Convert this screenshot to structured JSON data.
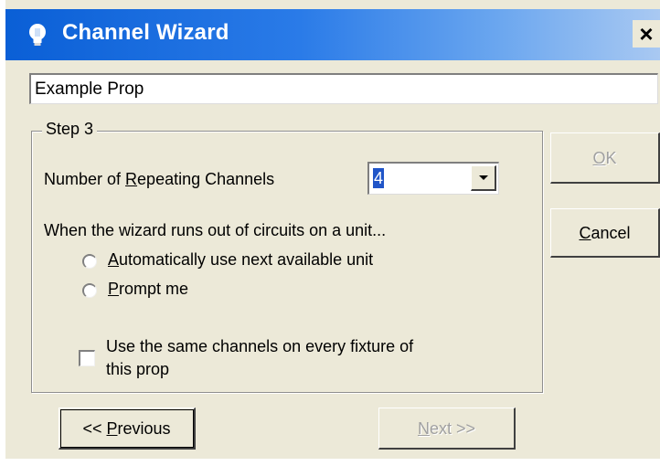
{
  "window": {
    "title": "Channel Wizard",
    "icon": "lightbulb-icon",
    "close_label": "×",
    "accent": "#0a5fd6"
  },
  "prop_name": {
    "value": "Example Prop"
  },
  "step": {
    "legend": "Step 3",
    "repeating_label_pre": "Number of ",
    "repeating_label_key": "R",
    "repeating_label_post": "epeating Channels",
    "repeating_value": "4",
    "outofcircuits_label": "When the wizard runs out of circuits on a unit...",
    "radio_auto": {
      "key": "A",
      "rest": "utomatically use next available unit",
      "selected": false
    },
    "radio_prompt": {
      "key": "P",
      "rest": "rompt me",
      "selected": false
    },
    "checkbox_same": {
      "line1": "Use the same channels on every fixture of",
      "line2": "this prop",
      "checked": false
    }
  },
  "buttons": {
    "ok": {
      "key": "O",
      "rest": "K",
      "enabled": false
    },
    "cancel": {
      "key": "C",
      "rest": "ancel",
      "enabled": true
    },
    "previous": {
      "pre": "<< ",
      "key": "P",
      "rest": "revious",
      "enabled": true
    },
    "next": {
      "key": "N",
      "rest": "ext >>",
      "enabled": false
    }
  }
}
